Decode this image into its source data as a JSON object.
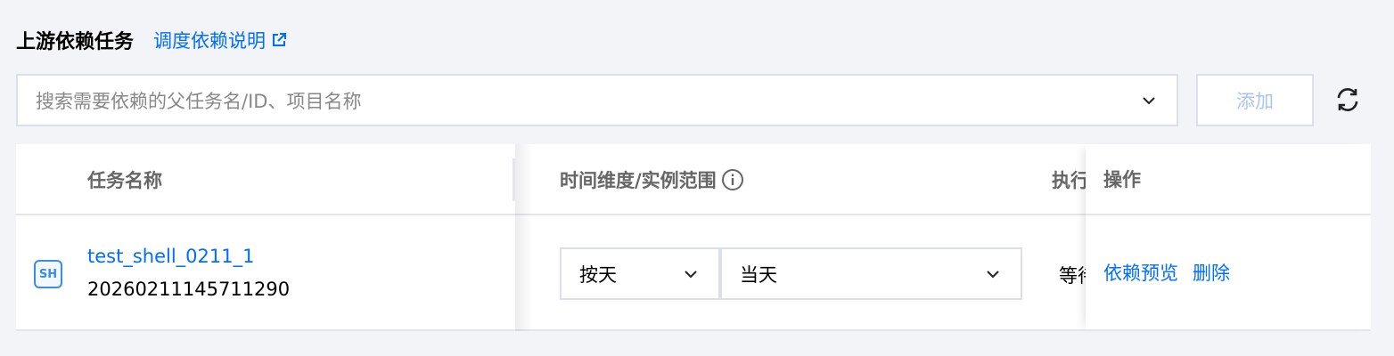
{
  "header": {
    "title": "上游依赖任务",
    "help_link": "调度依赖说明"
  },
  "search": {
    "placeholder": "搜索需要依赖的父任务名/ID、项目名称"
  },
  "toolbar": {
    "add_label": "添加"
  },
  "table": {
    "columns": {
      "name": "任务名称",
      "time": "时间维度/实例范围",
      "exec": "执行",
      "ops": "操作"
    },
    "rows": [
      {
        "type_badge": "SH",
        "task_name": "test_shell_0211_1",
        "task_id": "20260211145711290",
        "period": "按天",
        "range": "当天",
        "exec": "等待",
        "ops": {
          "preview": "依赖预览",
          "delete": "删除"
        }
      }
    ]
  },
  "colors": {
    "link": "#006eff",
    "border": "#dcdfe6",
    "disabled_text": "#a8c4f0",
    "background": "#f3f4f7"
  }
}
